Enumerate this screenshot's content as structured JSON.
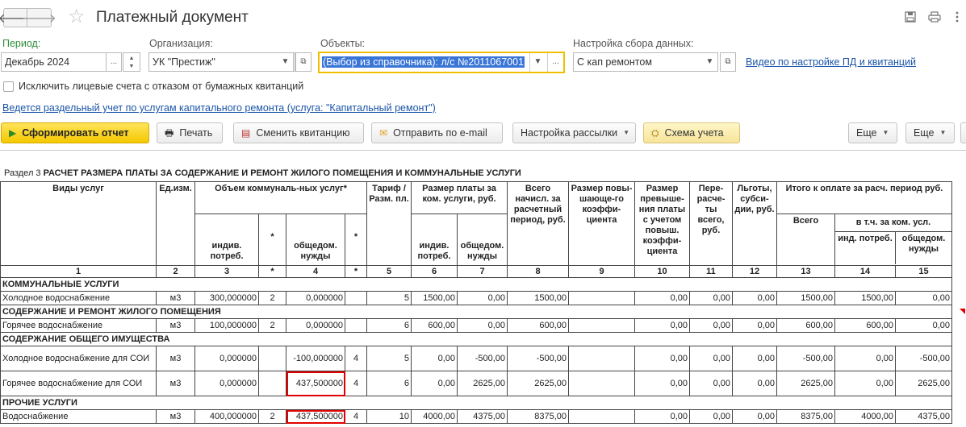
{
  "window": {
    "title": "Платежный документ",
    "back_glyph": "🡐",
    "forward_glyph": "🡒",
    "star_glyph": "☆",
    "icons": [
      "save-icon",
      "print-icon",
      "more-icon"
    ]
  },
  "filters": {
    "period": {
      "label": "Период:",
      "value": "Декабрь 2024",
      "button": "..."
    },
    "organization": {
      "label": "Организация:",
      "value": "УК \"Престиж\""
    },
    "objects": {
      "label": "Объекты:",
      "value": "(Выбор из справочника): л/с №2011067001",
      "button": "..."
    },
    "data_setup": {
      "label": "Настройка сбора данных:",
      "value": "С кап ремонтом"
    },
    "video_link": "Видео по настройке ПД и квитанций",
    "exclude_checkbox": {
      "label": "Исключить лицевые счета с отказом от бумажных квитанций",
      "checked": false
    },
    "capital_repair_link": "Ведется раздельный учет по услугам капитального ремонта (услуга: \"Капитальный ремонт\")"
  },
  "toolbar": {
    "generate": "Сформировать отчет",
    "print": "Печать",
    "change_receipt": "Сменить квитанцию",
    "send_email": "Отправить по e-mail",
    "mailing_setup": "Настройка рассылки",
    "scheme": "Схема учета",
    "more1": "Еще",
    "more2": "Еще"
  },
  "report": {
    "section_prefix": "Раздел 3",
    "section_title": "РАСЧЕТ РАЗМЕРА ПЛАТЫ ЗА СОДЕРЖАНИЕ И РЕМОНТ ЖИЛОГО ПОМЕЩЕНИЯ И КОММУНАЛЬНЫЕ УСЛУГИ",
    "headers": {
      "service": "Виды услуг",
      "unit": "Ед.изм.",
      "volume": "Объем коммуналь-ных услуг*",
      "volume_ind": "индив. потреб.",
      "star": "*",
      "volume_common": "общедом. нужды",
      "tariff": "Тариф / Разм. пл.",
      "pay_size": "Размер платы за ком. услуги, руб.",
      "pay_ind": "индив. потреб.",
      "pay_common": "общедом. нужды",
      "total_accrued": "Всего начисл. за расчетный период, руб.",
      "coef": "Размер повы-шающе-го коэффи-циента",
      "excess": "Размер превыше-ния платы с учетом повыш. коэффи-циента",
      "recalc": "Пере-расче-ты всего, руб.",
      "benefits": "Льготы, субси-дии, руб.",
      "total_due": "Итого к оплате за расч. период руб.",
      "due_all": "Всего",
      "due_incl": "в т.ч. за ком. усл.",
      "due_ind": "инд. потреб.",
      "due_common": "общедом. нужды"
    },
    "col_numbers": [
      "1",
      "2",
      "3",
      "*",
      "4",
      "*",
      "5",
      "6",
      "7",
      "8",
      "9",
      "10",
      "11",
      "12",
      "13",
      "14",
      "15"
    ],
    "groups": [
      {
        "title": "КОММУНАЛЬНЫЕ УСЛУГИ",
        "rows": [
          {
            "service": "Холодное водоснабжение",
            "unit": "м3",
            "vol_ind": "300,000000",
            "star1": "2",
            "vol_common": "0,000000",
            "star2": "",
            "tariff": "5",
            "pay_ind": "1500,00",
            "pay_common": "0,00",
            "total": "1500,00",
            "coef": "",
            "excess": "0,00",
            "recalc": "0,00",
            "benefits": "0,00",
            "due_all": "1500,00",
            "due_ind": "1500,00",
            "due_common": "0,00"
          }
        ]
      },
      {
        "title": "СОДЕРЖАНИЕ И РЕМОНТ ЖИЛОГО ПОМЕЩЕНИЯ",
        "rows": [
          {
            "service": "Горячее водоснабжение",
            "unit": "м3",
            "vol_ind": "100,000000",
            "star1": "2",
            "vol_common": "0,000000",
            "star2": "",
            "tariff": "6",
            "pay_ind": "600,00",
            "pay_common": "0,00",
            "total": "600,00",
            "coef": "",
            "excess": "0,00",
            "recalc": "0,00",
            "benefits": "0,00",
            "due_all": "600,00",
            "due_ind": "600,00",
            "due_common": "0,00"
          }
        ]
      },
      {
        "title": "СОДЕРЖАНИЕ ОБЩЕГО ИМУЩЕСТВА",
        "rows": [
          {
            "service": "Холодное водоснабжение для СОИ",
            "unit": "м3",
            "vol_ind": "0,000000",
            "star1": "",
            "vol_common": "-100,000000",
            "star2": "4",
            "tariff": "5",
            "pay_ind": "0,00",
            "pay_common": "-500,00",
            "total": "-500,00",
            "coef": "",
            "excess": "0,00",
            "recalc": "0,00",
            "benefits": "0,00",
            "due_all": "-500,00",
            "due_ind": "0,00",
            "due_common": "-500,00"
          },
          {
            "service": "Горячее водоснабжение для СОИ",
            "unit": "м3",
            "vol_ind": "0,000000",
            "star1": "",
            "vol_common": "437,500000",
            "star2": "4",
            "tariff": "6",
            "pay_ind": "0,00",
            "pay_common": "2625,00",
            "total": "2625,00",
            "coef": "",
            "excess": "0,00",
            "recalc": "0,00",
            "benefits": "0,00",
            "due_all": "2625,00",
            "due_ind": "0,00",
            "due_common": "2625,00"
          }
        ]
      },
      {
        "title": "ПРОЧИЕ УСЛУГИ",
        "rows": [
          {
            "service": "Водоснабжение",
            "unit": "м3",
            "vol_ind": "400,000000",
            "star1": "2",
            "vol_common": "437,500000",
            "star2": "4",
            "tariff": "10",
            "pay_ind": "4000,00",
            "pay_common": "4375,00",
            "total": "8375,00",
            "coef": "",
            "excess": "0,00",
            "recalc": "0,00",
            "benefits": "0,00",
            "due_all": "8375,00",
            "due_ind": "4000,00",
            "due_common": "4375,00"
          }
        ]
      }
    ]
  }
}
